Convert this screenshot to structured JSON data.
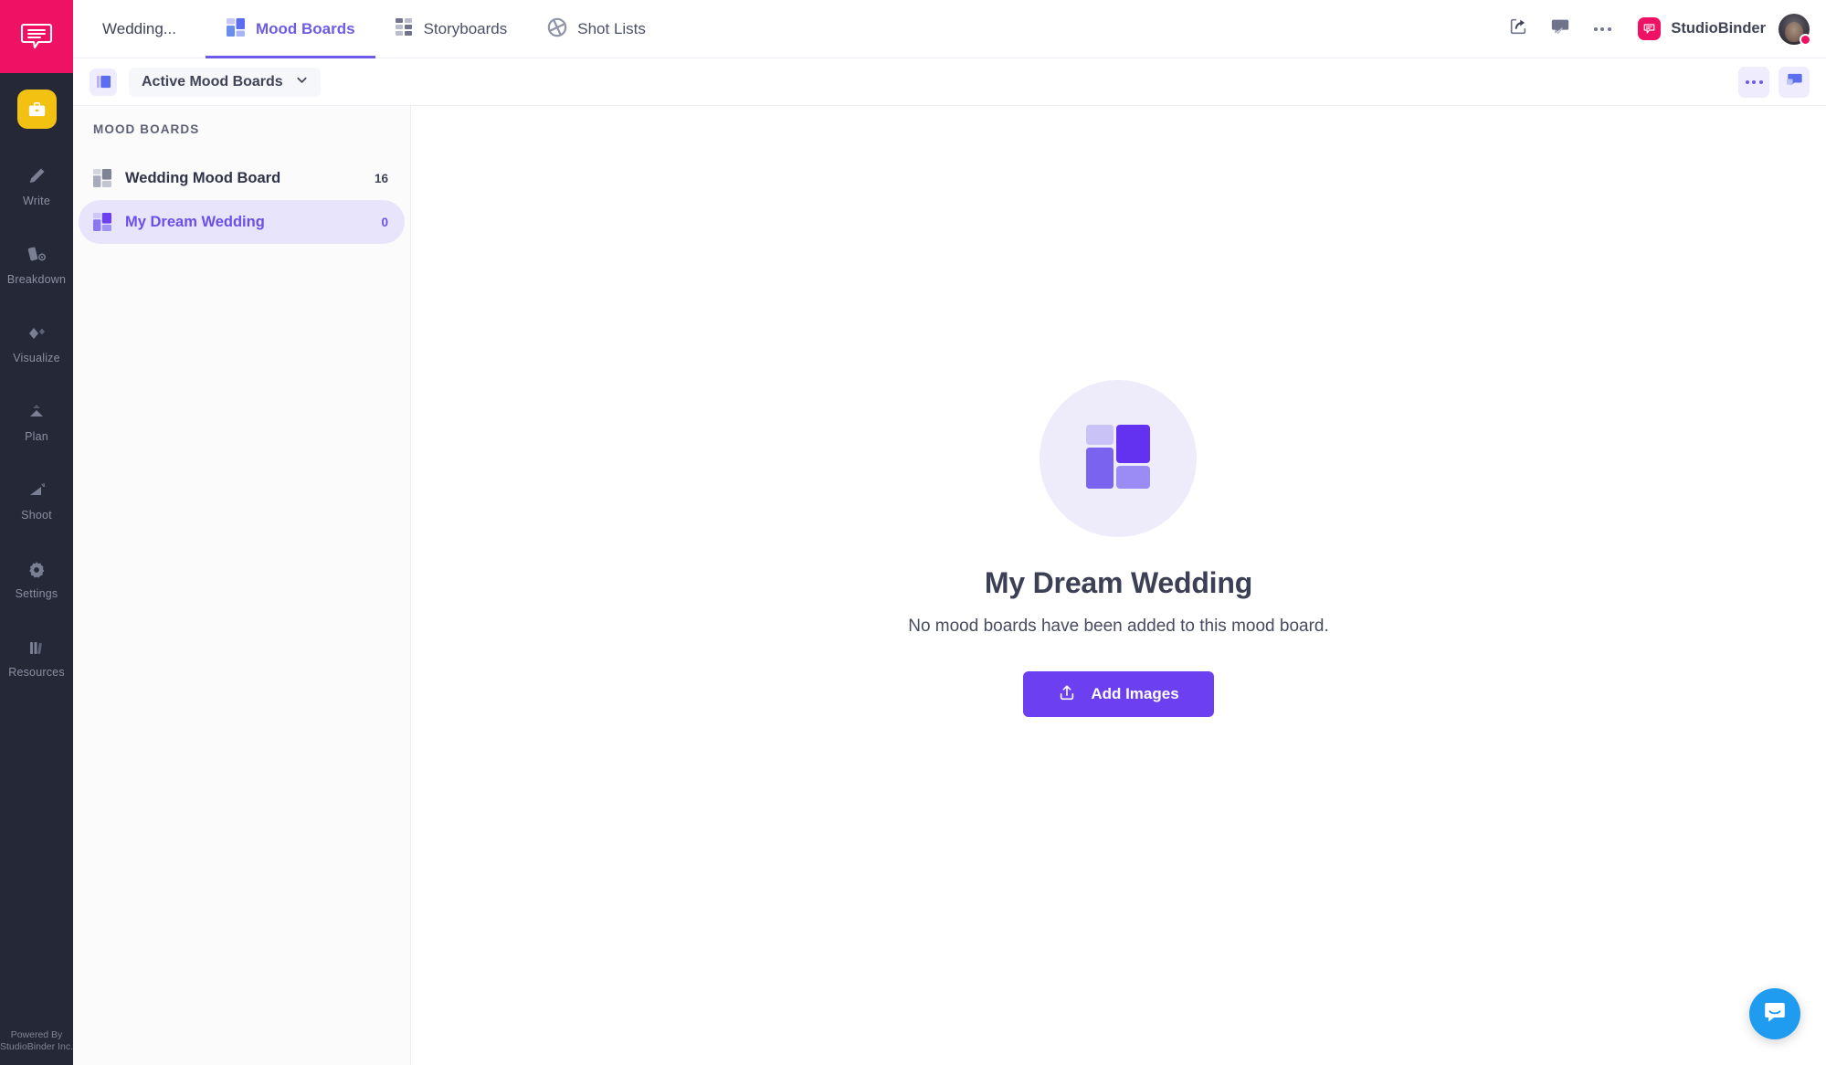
{
  "rail": {
    "logo_icon": "studiobinder-speech-bubble-logo",
    "project_icon": "briefcase-icon",
    "items": [
      {
        "label": "Write",
        "icon": "pencil-icon"
      },
      {
        "label": "Breakdown",
        "icon": "script-breakdown-icon"
      },
      {
        "label": "Visualize",
        "icon": "diamond-visualize-icon"
      },
      {
        "label": "Plan",
        "icon": "calendar-plan-icon"
      },
      {
        "label": "Shoot",
        "icon": "clapper-shoot-icon"
      },
      {
        "label": "Settings",
        "icon": "gear-icon"
      },
      {
        "label": "Resources",
        "icon": "books-resources-icon"
      }
    ],
    "footer_line1": "Powered By",
    "footer_line2": "StudioBinder Inc."
  },
  "topbar": {
    "project_tab": "Wedding...",
    "tabs": [
      {
        "label": "Mood Boards",
        "icon": "mood-board-icon",
        "active": true
      },
      {
        "label": "Storyboards",
        "icon": "storyboard-grid-icon",
        "active": false
      },
      {
        "label": "Shot Lists",
        "icon": "aperture-icon",
        "active": false
      }
    ],
    "share_icon": "share-arrow-icon",
    "comment_icon": "comment-approve-icon",
    "more_icon": "more-horizontal-icon",
    "brand_name": "StudioBinder",
    "brand_icon": "studiobinder-mark",
    "avatar_name": "user-avatar"
  },
  "subbar": {
    "board_icon": "mood-board-small-icon",
    "view_label": "Active Mood Boards",
    "chevron_icon": "chevron-down-icon",
    "more_icon": "more-horizontal-icon",
    "layout_icon": "layout-panel-icon"
  },
  "sidebar": {
    "section_title": "MOOD BOARDS",
    "items": [
      {
        "name": "Wedding Mood Board",
        "count": "16",
        "icon": "mood-board-grey-icon",
        "selected": false
      },
      {
        "name": "My Dream Wedding",
        "count": "0",
        "icon": "mood-board-purple-icon",
        "selected": true
      }
    ]
  },
  "main": {
    "empty_icon": "mood-board-large-icon",
    "title": "My Dream Wedding",
    "subtitle": "No mood boards have been added to this mood board.",
    "add_button": "Add Images",
    "add_button_icon": "upload-icon",
    "chat_icon": "intercom-chat-icon"
  },
  "colors": {
    "accent_purple": "#6c5ce7",
    "button_purple": "#6c3ff0",
    "brand_pink": "#ef1164",
    "project_yellow": "#f2c111",
    "rail_dark": "#252836",
    "selected_bg": "#e7e4fb",
    "chat_blue": "#1f9bf0"
  }
}
